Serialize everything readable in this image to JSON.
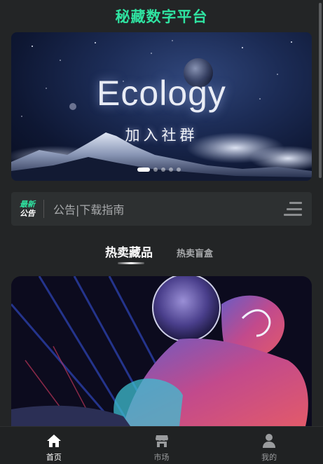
{
  "header": {
    "title": "秘藏数字平台"
  },
  "banner": {
    "headline": "Ecology",
    "subheadline": "加入社群",
    "slide_count": 5,
    "active_slide": 1
  },
  "notice": {
    "badge_top": "最新",
    "badge_bottom": "公告",
    "text": "公告|下载指南"
  },
  "tabs": [
    {
      "label": "热卖藏品",
      "active": true
    },
    {
      "label": "热卖盲盒",
      "active": false
    }
  ],
  "bottom_nav": [
    {
      "label": "首页",
      "icon": "home-icon",
      "active": true
    },
    {
      "label": "市场",
      "icon": "store-icon",
      "active": false
    },
    {
      "label": "我的",
      "icon": "user-icon",
      "active": false
    }
  ],
  "colors": {
    "accent": "#2fe3a1",
    "background": "#232526",
    "panel": "#2d3031"
  }
}
